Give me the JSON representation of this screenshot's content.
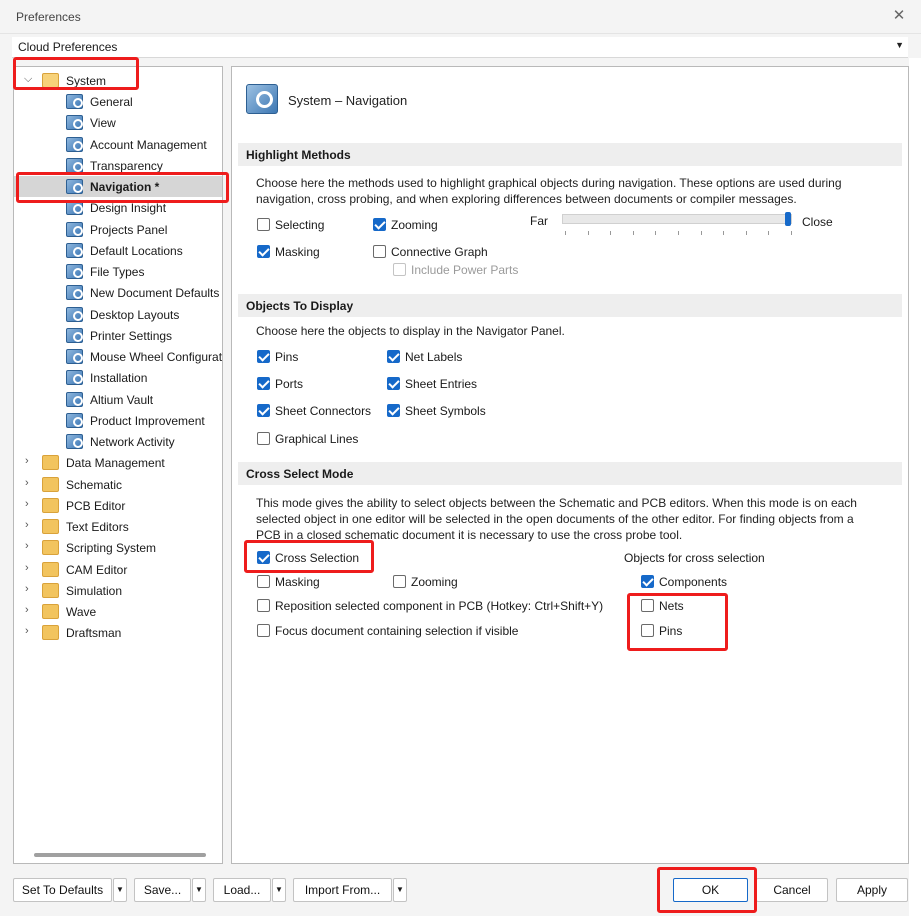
{
  "window": {
    "title": "Preferences"
  },
  "combo": {
    "value": "Cloud Preferences"
  },
  "tree": {
    "root": "System",
    "children": [
      "General",
      "View",
      "Account Management",
      "Transparency",
      "Navigation *",
      "Design Insight",
      "Projects Panel",
      "Default Locations",
      "File Types",
      "New Document Defaults",
      "Desktop Layouts",
      "Printer Settings",
      "Mouse Wheel Configurati",
      "Installation",
      "Altium Vault",
      "Product Improvement",
      "Network Activity"
    ],
    "folders": [
      "Data Management",
      "Schematic",
      "PCB Editor",
      "Text Editors",
      "Scripting System",
      "CAM Editor",
      "Simulation",
      "Wave",
      "Draftsman"
    ]
  },
  "panel": {
    "title": "System – Navigation",
    "highlight": {
      "heading": "Highlight Methods",
      "desc": "Choose here the methods used to highlight graphical objects during navigation. These options are used during navigation, cross probing, and when exploring differences between documents or compiler messages.",
      "selecting": "Selecting",
      "zooming": "Zooming",
      "masking": "Masking",
      "connective": "Connective Graph",
      "power": "Include Power Parts",
      "far": "Far",
      "close": "Close",
      "slider_level": 1.0
    },
    "objects": {
      "heading": "Objects To Display",
      "desc": "Choose here the objects to display in the Navigator Panel.",
      "pins": "Pins",
      "net_labels": "Net Labels",
      "ports": "Ports",
      "sheet_entries": "Sheet Entries",
      "sheet_connectors": "Sheet Connectors",
      "sheet_symbols": "Sheet Symbols",
      "graphical_lines": "Graphical Lines"
    },
    "cross": {
      "heading": "Cross Select Mode",
      "desc": "This mode gives the ability to select objects between the Schematic and PCB editors.  When this mode is on each selected object in one editor will be selected in the open documents of the other editor.  For finding objects from a PCB in a closed schematic document it is necessary to use the cross probe tool.",
      "cross_selection": "Cross Selection",
      "masking": "Masking",
      "zooming": "Zooming",
      "reposition": "Reposition selected component in PCB (Hotkey: Ctrl+Shift+Y)",
      "focus": "Focus document containing selection if visible",
      "objects_label": "Objects for cross selection",
      "components": "Components",
      "nets": "Nets",
      "pins": "Pins"
    }
  },
  "footer": {
    "defaults": "Set To Defaults",
    "save": "Save...",
    "load": "Load...",
    "import": "Import From...",
    "ok": "OK",
    "cancel": "Cancel",
    "apply": "Apply"
  },
  "colors": {
    "accent": "#1669c9",
    "highlight_box": "#ee1c1c"
  }
}
